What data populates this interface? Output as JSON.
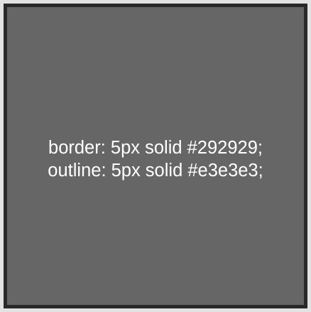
{
  "colors": {
    "outline": "#e3e3e3",
    "border": "#292929",
    "background": "#666666",
    "text": "#ffffff"
  },
  "box": {
    "lines": [
      "border: 5px solid #292929;",
      "outline: 5px solid #e3e3e3;"
    ]
  }
}
